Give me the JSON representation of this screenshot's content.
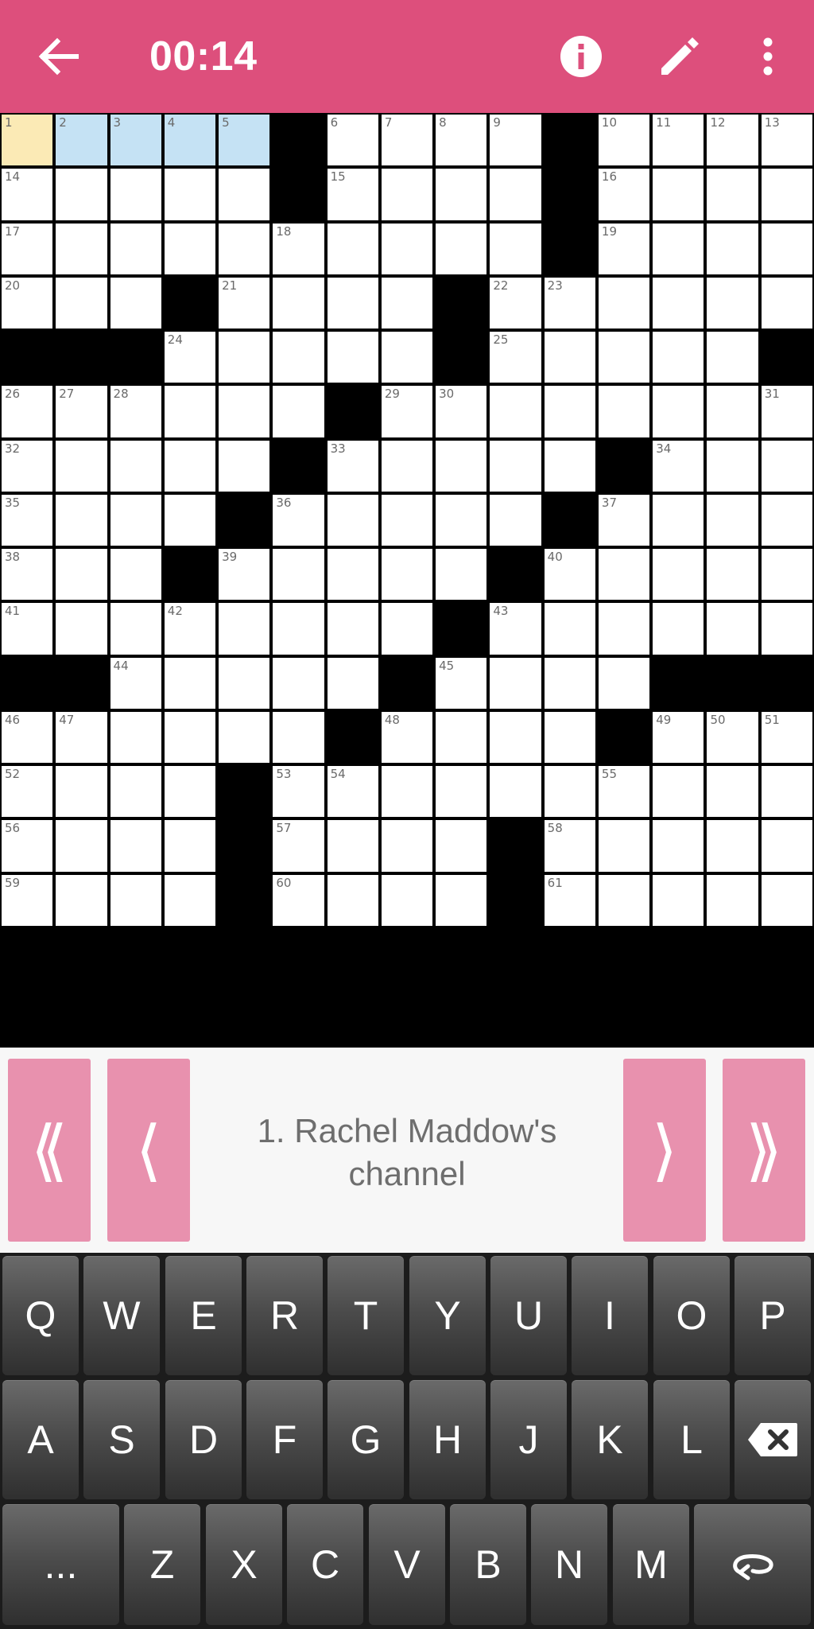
{
  "app": {
    "timer": "00:14",
    "colors": {
      "toolbar": "#dd4f7c",
      "nav_button": "#e891ae",
      "selected_cell": "#fbeab5",
      "highlighted_cell": "#c5e2f4"
    },
    "icons": {
      "back": "arrow-back-icon",
      "info": "info-icon",
      "edit": "pencil-icon",
      "more": "more-vert-icon"
    }
  },
  "grid": {
    "cols": 15,
    "rows": 15,
    "pattern": [
      ".....#....#....",
      ".....#....#....",
      "..........#....",
      "...#....#......",
      "###.....#.....#",
      "......#........",
      ".....#.....#...",
      "....#.....#....",
      "...#.....#.....",
      "........#......",
      "##.....#....###",
      "......#....#...",
      "....#..........",
      "....#....#.....",
      "....#....#....."
    ],
    "selected_cell": [
      0,
      0
    ],
    "highlighted_cells": [
      [
        0,
        1
      ],
      [
        0,
        2
      ],
      [
        0,
        3
      ],
      [
        0,
        4
      ]
    ]
  },
  "clue": {
    "text": "1. Rachel Maddow's channel",
    "nav": {
      "first": "⟪",
      "prev": "⟨",
      "next": "⟩",
      "last": "⟫"
    }
  },
  "keyboard": {
    "row1": [
      "Q",
      "W",
      "E",
      "R",
      "T",
      "Y",
      "U",
      "I",
      "O",
      "P"
    ],
    "row2": [
      "A",
      "S",
      "D",
      "F",
      "G",
      "H",
      "J",
      "K",
      "L"
    ],
    "row3": [
      "Z",
      "X",
      "C",
      "V",
      "B",
      "N",
      "M"
    ],
    "more_label": "...",
    "icons": {
      "backspace": "backspace-icon",
      "direction": "toggle-direction-icon"
    }
  }
}
